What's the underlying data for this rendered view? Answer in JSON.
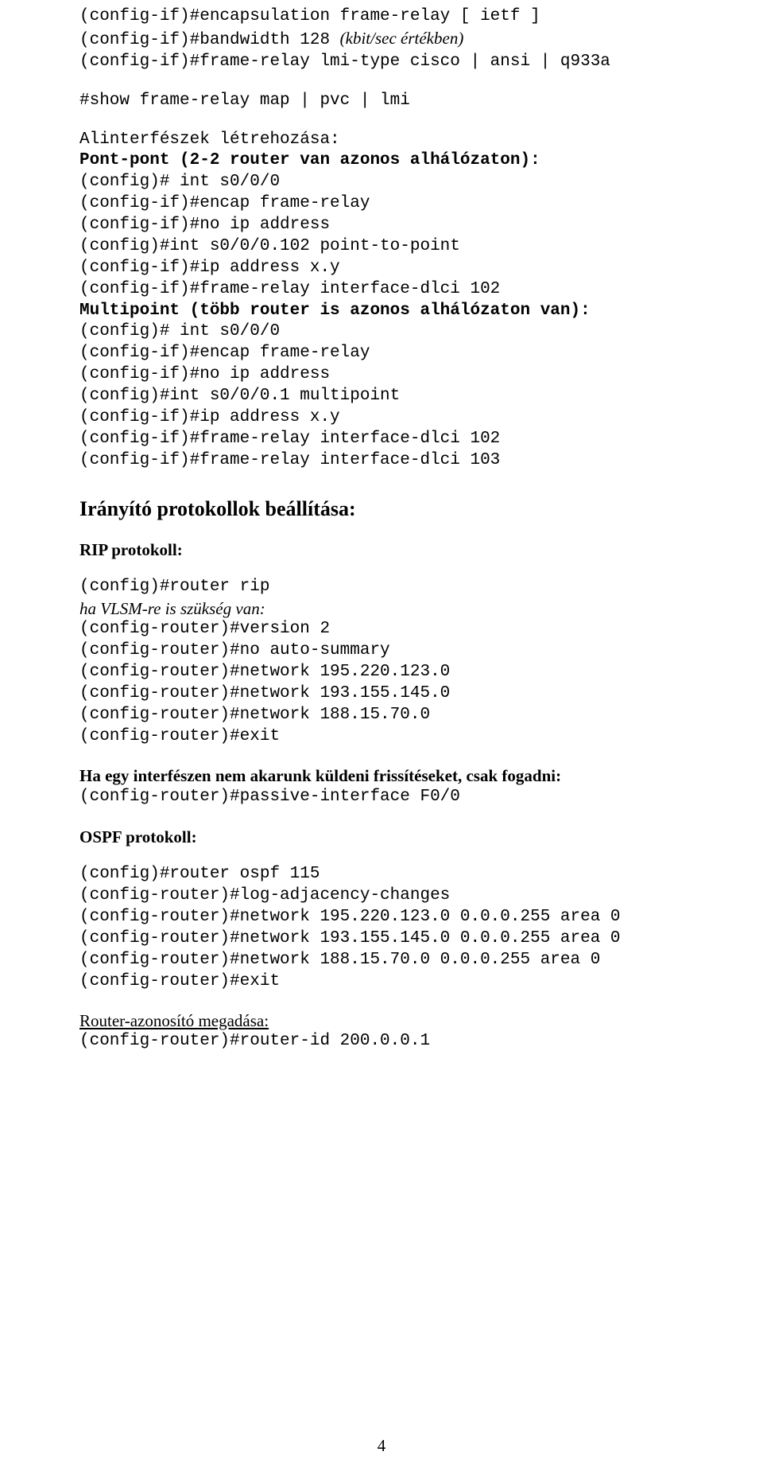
{
  "block1": {
    "l1": "(config-if)#encapsulation frame-relay [ ietf ]",
    "l2a": "(config-if)#bandwidth 128 ",
    "l2b": "(kbit/sec értékben)",
    "l3": "(config-if)#frame-relay lmi-type cisco | ansi | q933a",
    "l4": "#show frame-relay map | pvc | lmi"
  },
  "subif": {
    "title": "Alinterfészek létrehozása:",
    "pp_title": "Pont-pont (2-2 router van azonos alhálózaton):",
    "pp1": "(config)# int s0/0/0",
    "pp2": "(config-if)#encap frame-relay",
    "pp3": "(config-if)#no ip address",
    "pp4": "(config)#int s0/0/0.102 point-to-point",
    "pp5": "(config-if)#ip address x.y",
    "pp6": "(config-if)#frame-relay interface-dlci 102",
    "mp_title": "Multipoint (több router is azonos alhálózaton van):",
    "mp1": "(config)# int s0/0/0",
    "mp2": "(config-if)#encap frame-relay",
    "mp3": "(config-if)#no ip address",
    "mp4": "(config)#int s0/0/0.1 multipoint",
    "mp5": "(config-if)#ip address x.y",
    "mp6": "(config-if)#frame-relay interface-dlci 102",
    "mp7": "(config-if)#frame-relay interface-dlci 103"
  },
  "routing_heading": "Irányító protokollok beállítása:",
  "rip": {
    "heading": "RIP protokoll:",
    "l1": "(config)#router rip",
    "vlsm_note": "ha VLSM-re is szükség van:",
    "l2": "(config-router)#version 2",
    "l3": "(config-router)#no auto-summary",
    "l4": "(config-router)#network 195.220.123.0",
    "l5": "(config-router)#network 193.155.145.0",
    "l6": "(config-router)#network 188.15.70.0",
    "l7": "(config-router)#exit"
  },
  "passive": {
    "heading": "Ha egy interfészen nem akarunk küldeni frissítéseket, csak fogadni:",
    "l1": "(config-router)#passive-interface F0/0"
  },
  "ospf": {
    "heading": "OSPF protokoll:",
    "l1": "(config)#router ospf 115",
    "l2": "(config-router)#log-adjacency-changes",
    "l3": "(config-router)#network 195.220.123.0 0.0.0.255 area 0",
    "l4": "(config-router)#network 193.155.145.0 0.0.0.255 area 0",
    "l5": "(config-router)#network 188.15.70.0 0.0.0.255 area 0",
    "l6": "(config-router)#exit"
  },
  "routerid": {
    "heading": "Router-azonosító megadása:",
    "l1": "(config-router)#router-id 200.0.0.1"
  },
  "page_number": "4"
}
